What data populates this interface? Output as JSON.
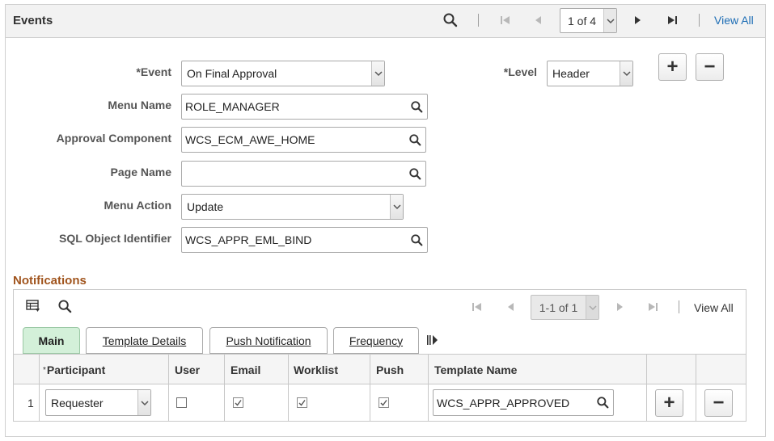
{
  "events": {
    "title": "Events",
    "pager": "1 of 4",
    "view_all": "View All",
    "event": {
      "label": "*Event",
      "value": "On Final Approval"
    },
    "level": {
      "label": "*Level",
      "value": "Header"
    },
    "menu_name": {
      "label": "Menu Name",
      "value": "ROLE_MANAGER"
    },
    "approval_component": {
      "label": "Approval Component",
      "value": "WCS_ECM_AWE_HOME"
    },
    "page_name": {
      "label": "Page Name",
      "value": ""
    },
    "menu_action": {
      "label": "Menu Action",
      "value": "Update"
    },
    "sql_object": {
      "label": "SQL Object Identifier",
      "value": "WCS_APPR_EML_BIND"
    },
    "add_symbol": "+",
    "remove_symbol": "−"
  },
  "notifications": {
    "title": "Notifications",
    "pager": "1-1 of 1",
    "view_all": "View All",
    "tabs": [
      "Main",
      "Template Details",
      "Push Notification",
      "Frequency"
    ],
    "columns": {
      "participant": "Participant",
      "participant_req": "*",
      "user": "User",
      "email": "Email",
      "worklist": "Worklist",
      "push": "Push",
      "template_name": "Template Name"
    },
    "rows": [
      {
        "num": "1",
        "participant": "Requester",
        "user": false,
        "email": true,
        "worklist": true,
        "push": true,
        "template_name": "WCS_APPR_APPROVED"
      }
    ],
    "add_symbol": "+",
    "remove_symbol": "−"
  }
}
